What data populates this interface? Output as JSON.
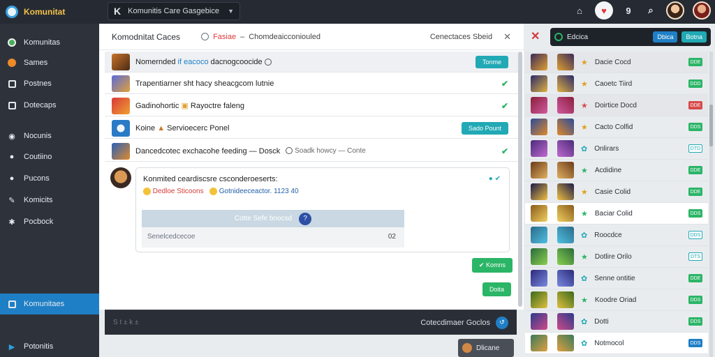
{
  "app": {
    "name": "Komunitat",
    "search_text": "Komunitis Care Gasgebice"
  },
  "topbar": {
    "icons": [
      "home-icon",
      "alert-icon",
      "help-icon",
      "search-icon"
    ]
  },
  "sidebar": {
    "items": [
      {
        "label": "Komunitas",
        "icon": "globe-icon"
      },
      {
        "label": "Sames",
        "icon": "fire-icon"
      },
      {
        "label": "Postnes",
        "icon": "box-icon"
      },
      {
        "label": "Dotecaps",
        "icon": "camera-icon"
      },
      {
        "label": "Nocunis",
        "icon": "compass-icon"
      },
      {
        "label": "Coutiino",
        "icon": "users-icon"
      },
      {
        "label": "Pucons",
        "icon": "people-icon"
      },
      {
        "label": "Komicits",
        "icon": "share-icon"
      },
      {
        "label": "Pocbock",
        "icon": "gear-icon"
      },
      {
        "label": "Komunitaes",
        "icon": "chart-icon",
        "active": true
      },
      {
        "label": "Potonitis",
        "icon": "play-icon"
      }
    ]
  },
  "main": {
    "title": "Komodnitat Caces",
    "filter_label": "Fasiae",
    "filter_sep": "–",
    "filter_text": "Chomdeaicconiouled",
    "head_right": "Cenectaces Sbeid",
    "rows": [
      {
        "pre": "Nomernded",
        "blue": "if eacoco",
        "rest": "dacnogcoocide",
        "action": "Tonme",
        "action_type": "teal",
        "hl": true
      },
      {
        "pre": "Trapentiarner",
        "rest": "sht hacy sheacgcom lutnie",
        "action_type": "check"
      },
      {
        "pre": "Gadinohortic",
        "rest": "Rayoctre faleng",
        "action_type": "check"
      },
      {
        "pre": "Koine",
        "rest": "Servioecerc Ponel",
        "action": "Sado Pount",
        "action_type": "teal"
      },
      {
        "pre": "Dancedcotec",
        "rest": "exchacohe feeding — Dosck",
        "extra": "Soadk howcy — Conte",
        "action_type": "check"
      }
    ],
    "comment": {
      "title": "Konmited ceardiscsre csconderoeserts:",
      "tag1": "Dedloe Sticoons",
      "tag2": "Gotnideeceactor.",
      "tag2_num": "1123 40",
      "bar_text": "Cotte Sefe bnocsd",
      "placeholder": "Senelcedcecoe",
      "count": "02"
    },
    "btn_green1": "Komns",
    "btn_green2": "Doita"
  },
  "footer": {
    "left": "S   t   ±   k   ±",
    "right": "Cotecdimaer Goclos",
    "mini": "Dlicane"
  },
  "right_panel": {
    "bar_label": "Edcica",
    "tab1": "Dbica",
    "tab2": "Botna",
    "items": [
      {
        "name": "Dacie Cocd",
        "badge": "DDE",
        "badge_type": "green",
        "star": "gold"
      },
      {
        "name": "Caoetc Tiird",
        "badge": "DDD",
        "badge_type": "green",
        "star": "gold"
      },
      {
        "name": "Doirtice Docd",
        "badge": "DDE",
        "badge_type": "red",
        "star": "red"
      },
      {
        "name": "Cacto Colfid",
        "badge": "DDS",
        "badge_type": "green",
        "star": "gold"
      },
      {
        "name": "Onlirars",
        "badge": "DTD",
        "badge_type": "outline",
        "star": "teal"
      },
      {
        "name": "Acdidine",
        "badge": "DDE",
        "badge_type": "green",
        "star": "green"
      },
      {
        "name": "Casie Colid",
        "badge": "DDE",
        "badge_type": "green",
        "star": "gold"
      },
      {
        "name": "Baciar Colid",
        "badge": "DDS",
        "badge_type": "green",
        "star": "green"
      },
      {
        "name": "Roocdce",
        "badge": "DDS",
        "badge_type": "outline",
        "star": "teal"
      },
      {
        "name": "Dotlire Orilo",
        "badge": "DTS",
        "badge_type": "outline",
        "star": "green"
      },
      {
        "name": "Senne ontitie",
        "badge": "DDE",
        "badge_type": "green",
        "star": "teal"
      },
      {
        "name": "Koodre Oriad",
        "badge": "DDS",
        "badge_type": "green",
        "star": "green"
      },
      {
        "name": "Dotti",
        "badge": "DDS",
        "badge_type": "green",
        "star": "teal"
      },
      {
        "name": "Notmocol",
        "badge": "DDS",
        "badge_type": "blue",
        "star": "teal"
      }
    ]
  }
}
